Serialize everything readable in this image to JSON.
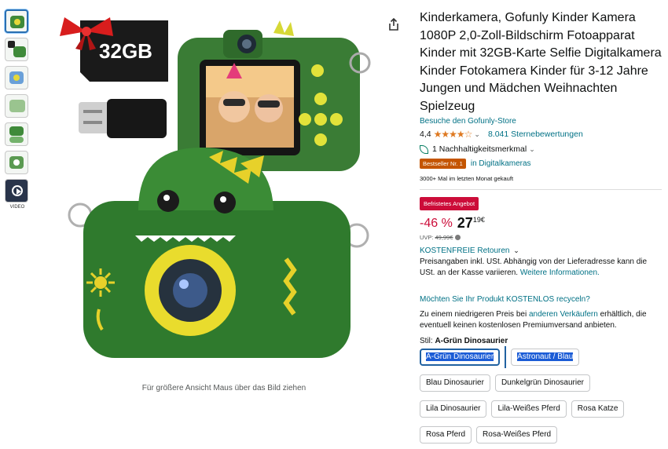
{
  "thumbnails": [
    {
      "name": "thumb-1"
    },
    {
      "name": "thumb-2"
    },
    {
      "name": "thumb-3"
    },
    {
      "name": "thumb-4"
    },
    {
      "name": "thumb-5"
    },
    {
      "name": "thumb-6"
    }
  ],
  "video_label": "VIDEO",
  "image": {
    "card_capacity": "32GB",
    "zoom_hint": "Für größere Ansicht Maus über das Bild ziehen"
  },
  "product": {
    "title": "Kinderkamera, Gofunly Kinder Kamera 1080P 2,0-Zoll-Bildschirm Fotoapparat Kinder mit 32GB-Karte Selfie Digitalkamera Kinder Fotokamera Kinder für 3-12 Jahre Jungen und Mädchen Weihnachten Spielzeug",
    "store_link": "Besuche den Gofunly-Store",
    "rating": "4,4",
    "stars": "★★★★☆",
    "ratings_count": "8.041 Sternebewertungen",
    "sustainability": "1 Nachhaltigkeitsmerkmal",
    "bestseller_badge": "Bestseller Nr. 1",
    "category": "in Digitalkameras",
    "bought": "3000+ Mal im letzten Monat gekauft"
  },
  "deal": {
    "badge": "Befristetes Angebot",
    "discount": "-46 %",
    "price_whole": "27",
    "price_cents": "19",
    "currency": "€",
    "uvp_label": "UVP:",
    "uvp_value": "49,99€"
  },
  "shipping": {
    "returns": "KOSTENFREIE Retouren",
    "note": "Preisangaben inkl. USt. Abhängig von der Lieferadresse kann die USt. an der Kasse variieren.",
    "more_info": "Weitere Informationen."
  },
  "recycle": {
    "question": "Möchten Sie Ihr Produkt KOSTENLOS recyceln?",
    "note_pre": "Zu einem niedrigeren Preis bei",
    "note_link": "anderen Verkäufern",
    "note_post": "erhältlich, die eventuell keinen kostenlosen Premiumversand anbieten."
  },
  "style": {
    "label": "Stil:",
    "value": "A-Grün Dinosaurier",
    "options_row1": [
      "A-Grün Dinosaurier",
      "Astronaut / Blau"
    ],
    "options_row2": [
      "Blau Dinosaurier",
      "Dunkelgrün Dinosaurier"
    ],
    "options_row3": [
      "Lila Dinosaurier",
      "Lila-Weißes Pferd",
      "Rosa Katze"
    ],
    "options_row4": [
      "Rosa Pferd",
      "Rosa-Weißes Pferd"
    ]
  },
  "colors": {
    "camera_green": "#3f8a3a",
    "lens_yellow": "#e4d83a",
    "link": "#007185",
    "deal_red": "#cc0c39",
    "bestseller_orange": "#c45500"
  }
}
